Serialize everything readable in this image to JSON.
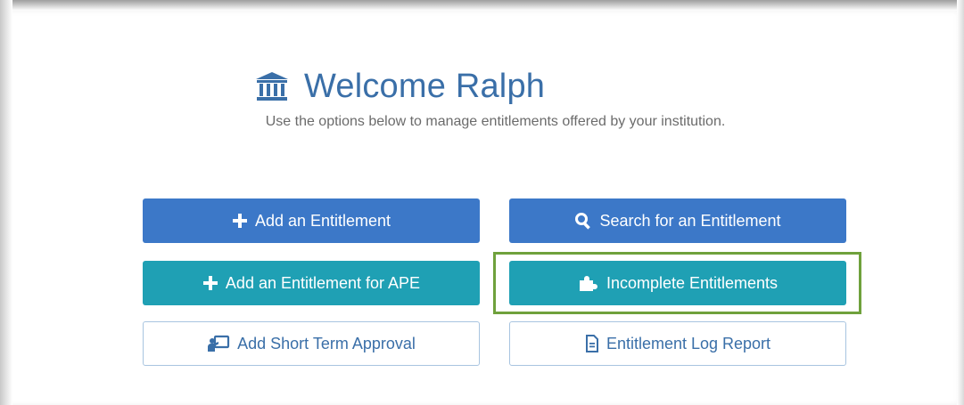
{
  "header": {
    "title": "Welcome Ralph",
    "title_icon": "institution-icon",
    "subtitle": "Use the options below to manage entitlements offered by your institution."
  },
  "actions": {
    "add_entitlement": {
      "label": "Add an Entitlement",
      "icon": "plus-icon"
    },
    "search_entitlement": {
      "label": "Search for an Entitlement",
      "icon": "search-icon"
    },
    "add_entitlement_ape": {
      "label": "Add an Entitlement for APE",
      "icon": "plus-icon"
    },
    "incomplete_entitlements": {
      "label": "Incomplete Entitlements",
      "icon": "puzzle-icon",
      "highlighted": true
    },
    "add_short_term_approval": {
      "label": "Add Short Term Approval",
      "icon": "teacher-board-icon"
    },
    "entitlement_log_report": {
      "label": "Entitlement Log Report",
      "icon": "document-icon"
    }
  },
  "colors": {
    "primary_blue": "#3c78c8",
    "teal": "#1fa0b4",
    "title_blue": "#3a6fa8",
    "highlight_green": "#6fa13c",
    "outline_border": "#a8c4e0"
  }
}
